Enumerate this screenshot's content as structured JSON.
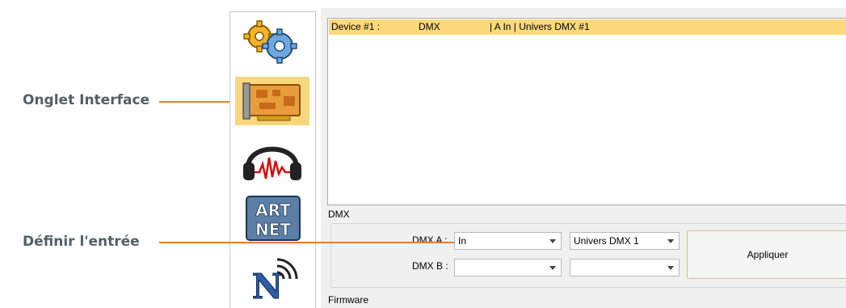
{
  "callouts": {
    "interface_tab": "Onglet Interface",
    "define_input": "Définir l'entrée"
  },
  "sidebar": {
    "items": [
      {
        "icon": "gears-icon",
        "active": false
      },
      {
        "icon": "interface-card-icon",
        "active": true
      },
      {
        "icon": "headphones-icon",
        "active": false
      },
      {
        "icon": "artnet-icon",
        "active": false,
        "text_top": "ART",
        "text_bottom": "NET"
      },
      {
        "icon": "network-n-icon",
        "active": false
      }
    ]
  },
  "device_list": {
    "rows": [
      {
        "device": "Device #1 :",
        "protocol": "DMX",
        "details": "| A In | Univers DMX #1",
        "selected": true
      }
    ]
  },
  "dmx": {
    "section_label": "DMX",
    "dmx_a_label": "DMX A :",
    "dmx_b_label": "DMX B :",
    "dmx_a_mode": "In",
    "dmx_a_universe": "Univers DMX 1",
    "dmx_b_mode": "",
    "dmx_b_universe": "",
    "apply_label": "Appliquer"
  },
  "firmware": {
    "section_label": "Firmware"
  },
  "colors": {
    "accent_orange": "#ec7b2c",
    "selection_yellow": "#fcd97b",
    "active_tab": "#f8d77c"
  }
}
